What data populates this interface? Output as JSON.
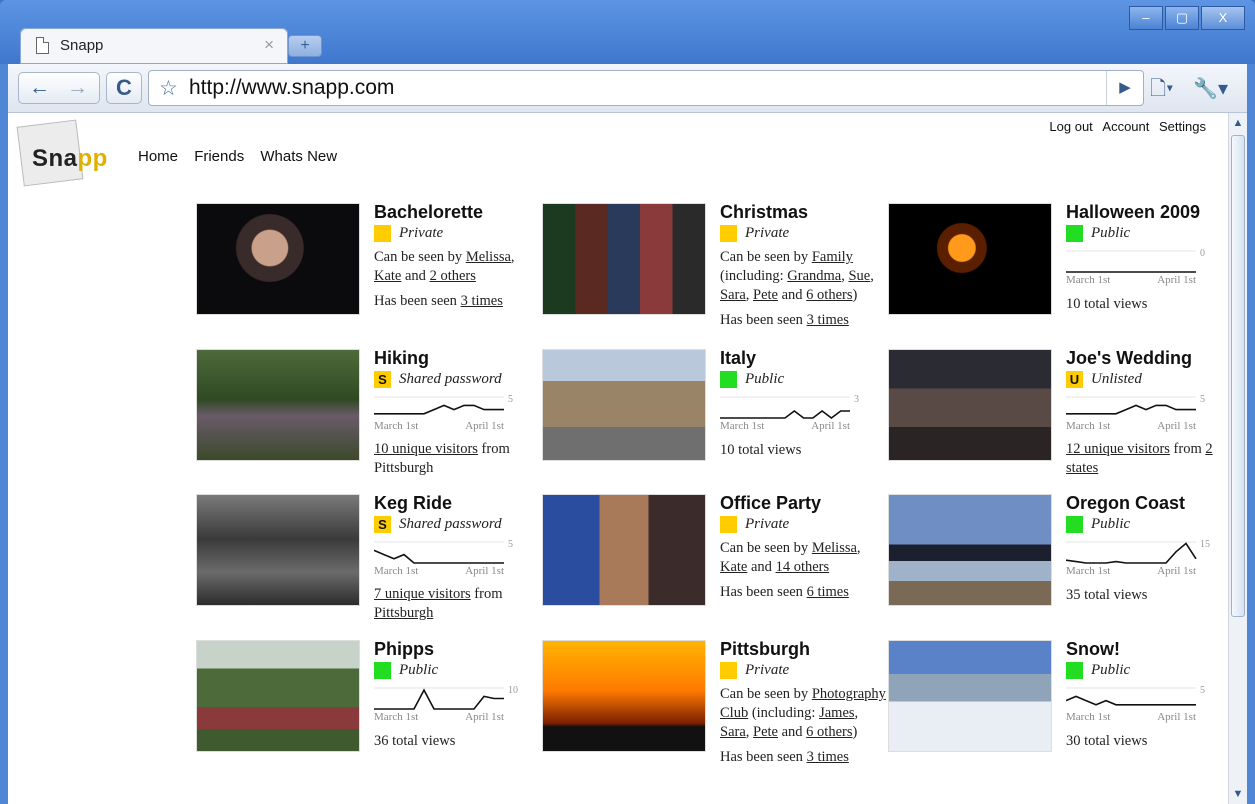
{
  "browser": {
    "tab_title": "Snapp",
    "tab_close": "×",
    "new_tab": "+",
    "url": "http://www.snapp.com",
    "window_buttons": [
      "–",
      "▢",
      "X"
    ]
  },
  "site": {
    "logo_text_main": "Sna",
    "logo_text_accent": "pp",
    "nav": [
      "Home",
      "Friends",
      "Whats New"
    ],
    "user_nav": [
      "Log out",
      "Account",
      "Settings"
    ]
  },
  "colors": {
    "private": "#ffcc00",
    "public": "#22dd22",
    "shared": "#ffcc00",
    "unlisted": "#ffcc00"
  },
  "albums": [
    {
      "title": "Bachelorette",
      "privacy_badge": "",
      "privacy_color": "yellow",
      "privacy": "Private",
      "desc_parts": [
        "Can be seen by ",
        "Melissa",
        ", ",
        "Kate",
        " and ",
        "2 others"
      ],
      "seen_prefix": "Has been seen ",
      "seen_link": "3 times"
    },
    {
      "title": "Christmas",
      "privacy_badge": "",
      "privacy_color": "yellow",
      "privacy": "Private",
      "desc_parts": [
        "Can be seen by ",
        "Family",
        " (including: ",
        "Grandma",
        ", ",
        "Sue",
        ", ",
        "Sara",
        ", ",
        "Pete",
        " and ",
        "6 others",
        ")"
      ],
      "seen_prefix": "Has been seen ",
      "seen_link": "3 times"
    },
    {
      "title": "Halloween 2009",
      "privacy_badge": "",
      "privacy_color": "green",
      "privacy": "Public",
      "spark_max": "0",
      "spark_left": "March 1st",
      "spark_right": "April 1st",
      "values": [
        0,
        0,
        0,
        0,
        0,
        0,
        0,
        0,
        0,
        0
      ],
      "views": "10 total views"
    },
    {
      "title": "Hiking",
      "privacy_badge": "S",
      "privacy_color": "yellow",
      "privacy": "Shared password",
      "spark_max": "5",
      "spark_left": "March 1st",
      "spark_right": "April 1st",
      "values": [
        1,
        1,
        1,
        1,
        1,
        1,
        2,
        3,
        2,
        3,
        3,
        2,
        2,
        2
      ],
      "visit_link": "10 unique visitors",
      "visit_mid": " from ",
      "visit_place": "Pittsburgh",
      "visit_place_link": false
    },
    {
      "title": "Italy",
      "privacy_badge": "",
      "privacy_color": "green",
      "privacy": "Public",
      "spark_max": "3",
      "spark_left": "March 1st",
      "spark_right": "April 1st",
      "values": [
        0,
        0,
        0,
        0,
        0,
        0,
        0,
        0,
        1,
        0,
        0,
        1,
        0,
        1,
        1
      ],
      "views": "10 total views"
    },
    {
      "title": "Joe's Wedding",
      "privacy_badge": "U",
      "privacy_color": "yellow",
      "privacy": "Unlisted",
      "spark_max": "5",
      "spark_left": "March 1st",
      "spark_right": "April 1st",
      "values": [
        1,
        1,
        1,
        1,
        1,
        1,
        2,
        3,
        2,
        3,
        3,
        2,
        2,
        2
      ],
      "visit_link": "12 unique visitors",
      "visit_mid": " from ",
      "visit_place": "2 states",
      "visit_place_link": true
    },
    {
      "title": "Keg Ride",
      "privacy_badge": "S",
      "privacy_color": "yellow",
      "privacy": "Shared password",
      "spark_max": "5",
      "spark_left": "March 1st",
      "spark_right": "April 1st",
      "values": [
        3,
        2,
        1,
        2,
        0,
        0,
        0,
        0,
        0,
        0,
        0,
        0,
        0,
        0
      ],
      "visit_link": "7 unique visitors",
      "visit_mid": " from ",
      "visit_place": "Pittsburgh",
      "visit_place_link": true
    },
    {
      "title": "Office Party",
      "privacy_badge": "",
      "privacy_color": "yellow",
      "privacy": "Private",
      "desc_parts": [
        "Can be seen by ",
        "Melissa",
        ", ",
        "Kate",
        " and ",
        "14 others"
      ],
      "seen_prefix": "Has been seen ",
      "seen_link": "6 times"
    },
    {
      "title": "Oregon Coast",
      "privacy_badge": "",
      "privacy_color": "green",
      "privacy": "Public",
      "spark_max": "15",
      "spark_left": "March 1st",
      "spark_right": "April 1st",
      "values": [
        2,
        1,
        0,
        0,
        0,
        1,
        0,
        0,
        0,
        0,
        0,
        8,
        14,
        3
      ],
      "views": "35 total views"
    },
    {
      "title": "Phipps",
      "privacy_badge": "",
      "privacy_color": "green",
      "privacy": "Public",
      "spark_max": "10",
      "spark_left": "March 1st",
      "spark_right": "April 1st",
      "values": [
        0,
        0,
        0,
        0,
        0,
        9,
        0,
        0,
        0,
        0,
        0,
        6,
        5,
        5
      ],
      "views": "36 total views"
    },
    {
      "title": "Pittsburgh",
      "privacy_badge": "",
      "privacy_color": "yellow",
      "privacy": "Private",
      "desc_parts": [
        "Can be seen by ",
        "Photography Club",
        " (including: ",
        "James",
        ", ",
        "Sara",
        ", ",
        "Pete",
        " and ",
        "6 others",
        ")"
      ],
      "seen_prefix": "Has been seen ",
      "seen_link": "3 times"
    },
    {
      "title": "Snow!",
      "privacy_badge": "",
      "privacy_color": "green",
      "privacy": "Public",
      "spark_max": "5",
      "spark_left": "March 1st",
      "spark_right": "April 1st",
      "values": [
        2,
        3,
        2,
        1,
        2,
        1,
        1,
        1,
        1,
        1,
        1,
        1,
        1,
        1
      ],
      "views": "30 total views"
    }
  ]
}
